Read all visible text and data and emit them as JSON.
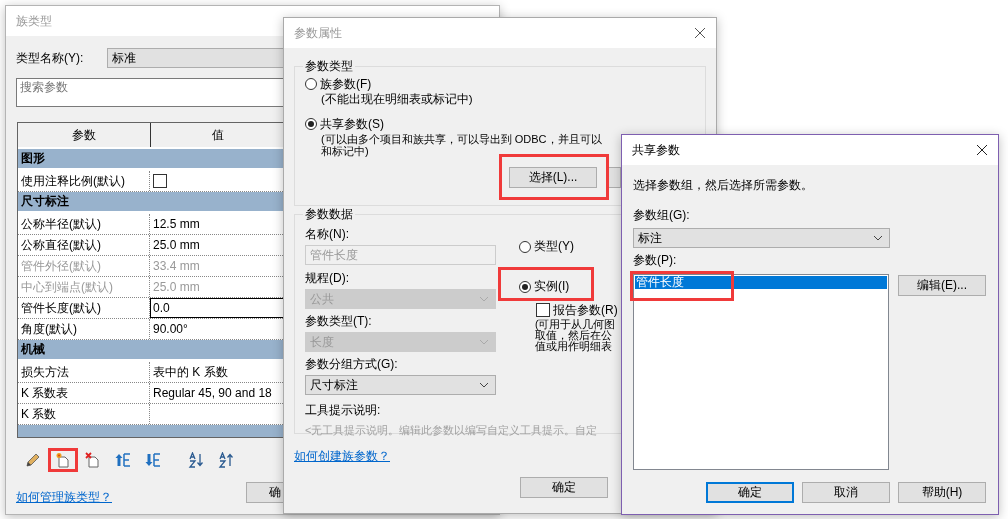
{
  "family_types_window": {
    "title": "族类型",
    "active": false,
    "type_name_label": "类型名称(Y):",
    "type_name": "标准",
    "search": {
      "placeholder": "搜索参数"
    },
    "table": {
      "columns": [
        "参数",
        "值"
      ],
      "rows": [
        {
          "kind": "group",
          "label": "图形"
        },
        {
          "kind": "checkbox",
          "name": "使用注释比例(默认)",
          "checked": false,
          "disabled": false
        },
        {
          "kind": "group",
          "label": "尺寸标注"
        },
        {
          "kind": "text",
          "name": "公称半径(默认)",
          "value": "12.5 mm",
          "disabled": false
        },
        {
          "kind": "text",
          "name": "公称直径(默认)",
          "value": "25.0 mm",
          "disabled": false
        },
        {
          "kind": "text",
          "name": "管件外径(默认)",
          "value": "33.4 mm",
          "disabled": true
        },
        {
          "kind": "text",
          "name": "中心到端点(默认)",
          "value": "25.0 mm",
          "disabled": true
        },
        {
          "kind": "edit",
          "name": "管件长度(默认)",
          "value": "0.0",
          "disabled": false
        },
        {
          "kind": "text",
          "name": "角度(默认)",
          "value": "90.00°",
          "disabled": false
        },
        {
          "kind": "group",
          "label": "机械"
        },
        {
          "kind": "text",
          "name": "损失方法",
          "value": "表中的 K 系数",
          "disabled": false
        },
        {
          "kind": "text",
          "name": "K 系数表",
          "value": "Regular 45, 90 and 18",
          "disabled": false
        },
        {
          "kind": "text",
          "name": "K 系数",
          "disabled": false
        },
        {
          "kind": "group"
        }
      ]
    },
    "toolbar": [
      {
        "kind": "pencil",
        "highlighted": false
      },
      {
        "kind": "new",
        "highlighted": true
      },
      {
        "kind": "delete",
        "highlighted": false
      },
      {
        "kind": "move_up",
        "highlighted": false
      },
      {
        "kind": "move_down",
        "highlighted": false
      },
      {
        "kind": "sort_ascending",
        "highlighted": false
      },
      {
        "kind": "sort_descending",
        "highlighted": false
      }
    ],
    "help_link": "如何管理族类型？",
    "ok_button": "确"
  },
  "parameter_properties_window": {
    "title": "参数属性",
    "active": false,
    "parameter_type": {
      "label": "参数类型",
      "options": [
        {
          "label": "族参数(F)",
          "note_lines": [
            "(不能出现在明细表或标记中)"
          ],
          "selected": false
        },
        {
          "label": "共享参数(S)",
          "note_lines": [
            "(可以由多个项目和族共享，可以导出到 ODBC，并且可以",
            "和标记中)"
          ],
          "selected": true
        }
      ],
      "select_button": {
        "label": "选择(L)...",
        "highlighted": true
      }
    },
    "parameter_data": {
      "label": "参数数据",
      "name_label": "名称(N):",
      "name_value": "管件长度",
      "name_disabled": true,
      "fields": [
        {
          "label": "规程(D):",
          "value": "公共",
          "disabled": true
        },
        {
          "label": "参数类型(T):",
          "value": "长度",
          "disabled": true
        },
        {
          "label": "参数分组方式(G):",
          "value": "尺寸标注",
          "disabled": false
        }
      ],
      "scope": [
        {
          "label": "类型(Y)",
          "selected": false,
          "highlighted": false
        },
        {
          "label": "实例(I)",
          "selected": true,
          "highlighted": true
        }
      ],
      "reporting": {
        "label": "报告参数(R)",
        "checked": false,
        "note_lines": [
          "(可用于从几何图",
          "取值，然后在公",
          "值或用作明细表"
        ]
      },
      "tooltip_label": "工具提示说明:",
      "tooltip": "<无工具提示说明。编辑此参数以编写自定义工具提示。自定"
    },
    "help_link": "如何创建族参数？",
    "ok_button": "确定"
  },
  "shared_parameters_window": {
    "title": "共享参数",
    "active": true,
    "instruction": "选择参数组，然后选择所需参数。",
    "group_label": "参数组(G):",
    "group_value": "标注",
    "parameters_label": "参数(P):",
    "parameters": [
      {
        "label": "管件长度",
        "selected": true,
        "highlighted": true
      }
    ],
    "edit_button": "编辑(E)...",
    "buttons": [
      {
        "label": "确定",
        "default": true
      },
      {
        "label": "取消",
        "default": false
      },
      {
        "label": "帮助(H)",
        "default": false
      }
    ]
  }
}
